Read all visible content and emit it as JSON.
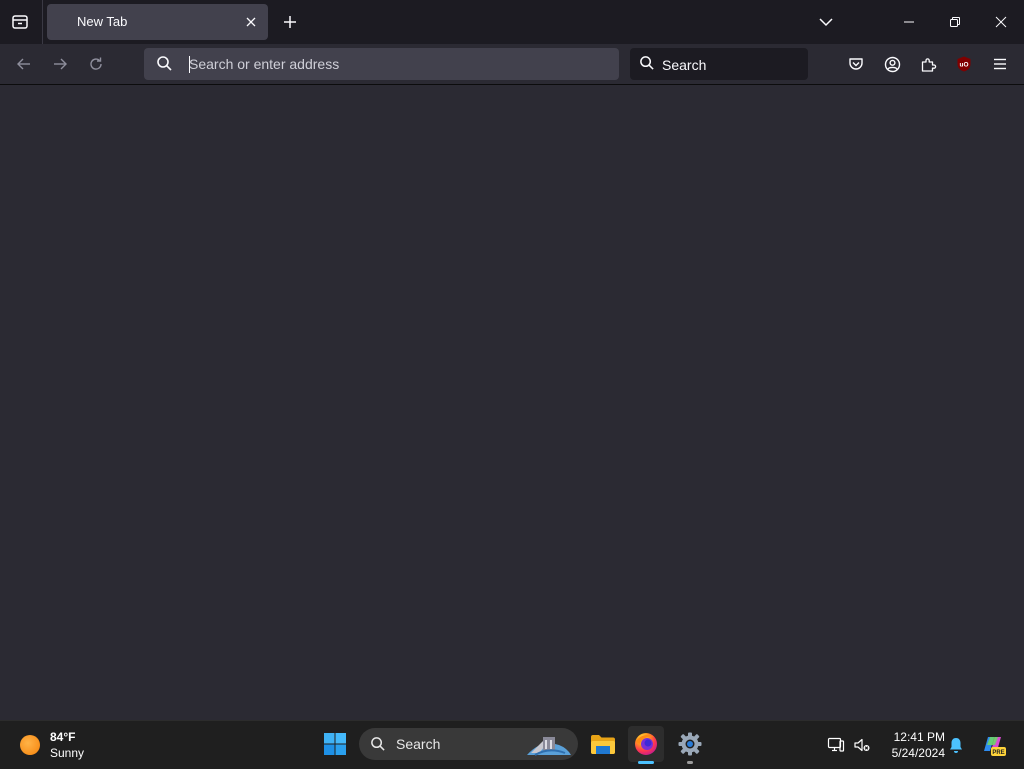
{
  "browser": {
    "tab": {
      "title": "New Tab"
    },
    "urlbar": {
      "placeholder": "Search or enter address",
      "value": ""
    },
    "searchbar": {
      "placeholder": "Search",
      "value": ""
    },
    "extension_badge": "uO"
  },
  "taskbar": {
    "weather": {
      "temperature": "84°F",
      "condition": "Sunny"
    },
    "search": {
      "label": "Search"
    },
    "clock": {
      "time": "12:41 PM",
      "date": "5/24/2024"
    },
    "copilot_badge": "PRE"
  },
  "colors": {
    "tab_strip": "#1c1b22",
    "toolbar": "#2b2a33",
    "urlbar": "#42414d",
    "taskbar": "#1f1f1f",
    "accent_running": "#4cc2ff",
    "ublock_red": "#800000"
  },
  "icons": [
    "firefox-view-icon",
    "close-icon",
    "plus-icon",
    "chevron-down-icon",
    "minimize-icon",
    "restore-icon",
    "window-close-icon",
    "back-arrow-icon",
    "forward-arrow-icon",
    "reload-icon",
    "search-icon",
    "pocket-icon",
    "account-icon",
    "puzzle-icon",
    "ublock-icon",
    "hamburger-menu-icon",
    "sun-icon",
    "windows-logo-icon",
    "file-explorer-icon",
    "firefox-icon",
    "gear-icon",
    "network-icon",
    "volume-muted-icon",
    "bell-icon",
    "copilot-icon"
  ]
}
